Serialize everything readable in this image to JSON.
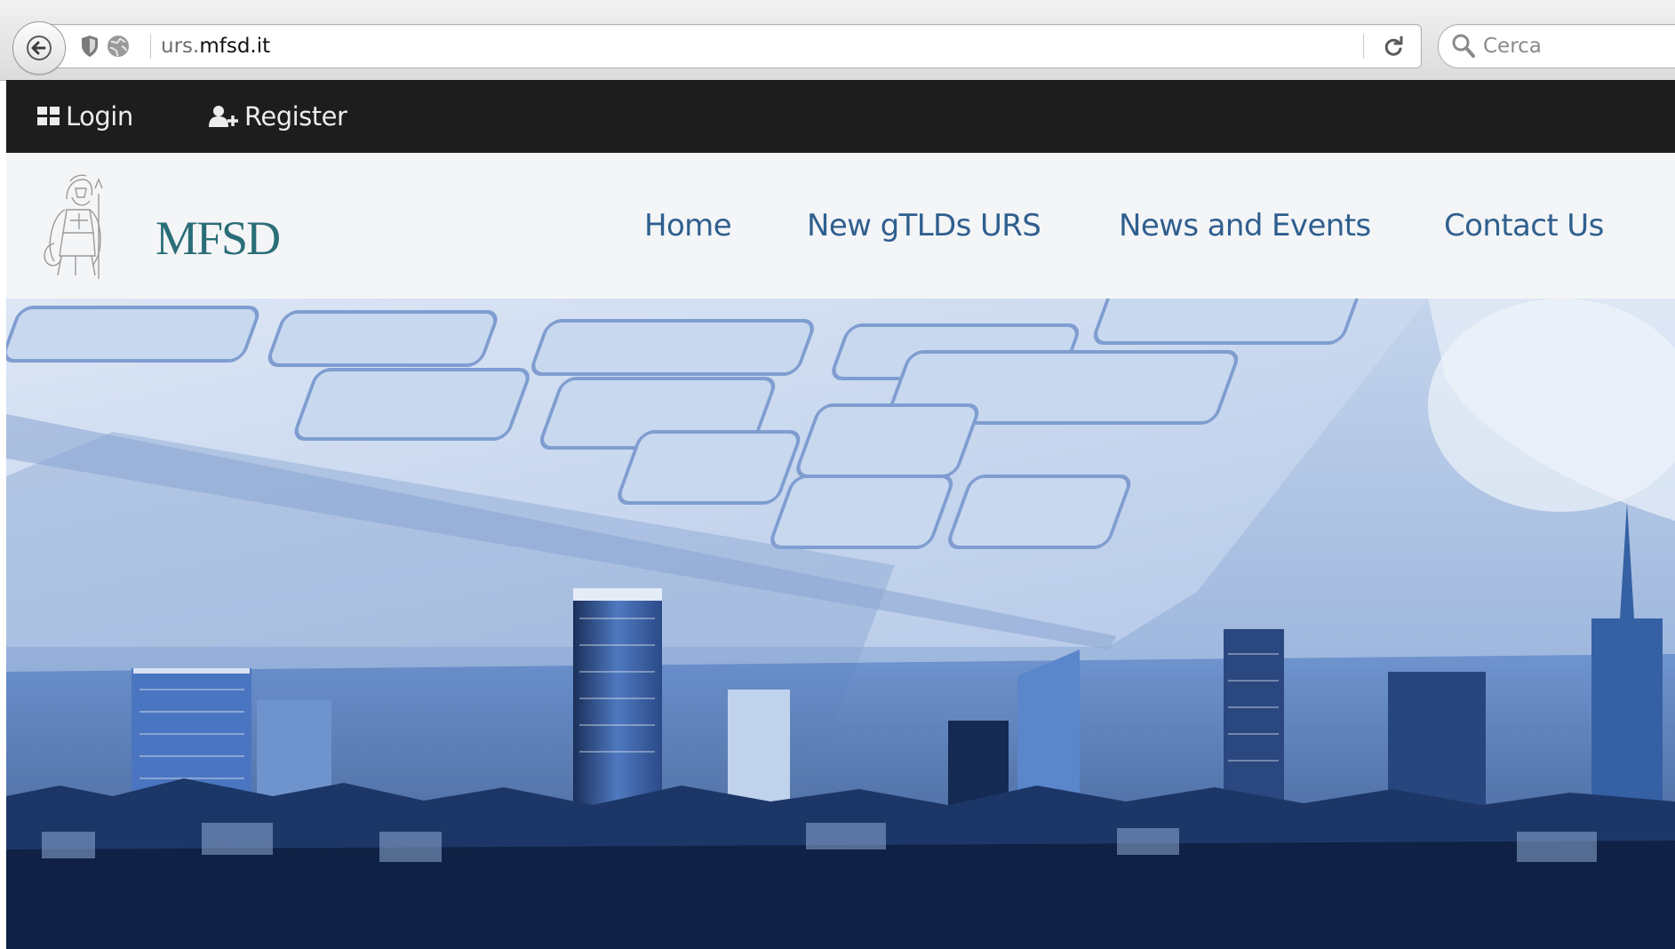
{
  "browser": {
    "url_prefix": "urs.",
    "url_domain": "mfsd.it",
    "search_placeholder": "Cerca",
    "icons": [
      "back-arrow-icon",
      "shield-icon",
      "globe-icon",
      "reload-icon",
      "search-icon"
    ]
  },
  "topbar": {
    "login_label": "Login",
    "register_label": "Register",
    "background": "#1d1d1d"
  },
  "header": {
    "logo_text": "MFSD",
    "logo_color": "#2a6e78",
    "nav": [
      {
        "label": "Home"
      },
      {
        "label": "New gTLDs URS"
      },
      {
        "label": "News and Events"
      },
      {
        "label": "Contact Us"
      }
    ],
    "nav_color": "#2f5f8f"
  },
  "hero": {
    "image": "keyboard-and-city-skyline",
    "tint": "#3f6fbf"
  }
}
